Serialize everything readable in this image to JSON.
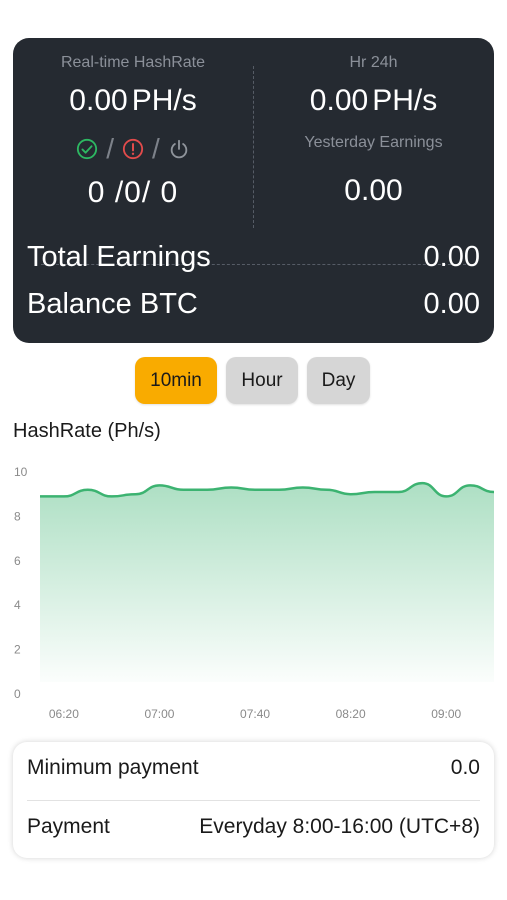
{
  "stats": {
    "realtime_label": "Real-time HashRate",
    "realtime_value": "0.00",
    "realtime_unit": "PH/s",
    "hr24_label": "Hr 24h",
    "hr24_value": "0.00",
    "hr24_unit": "PH/s",
    "status_separator": "/",
    "workers_active": "0",
    "workers_inactive": "0",
    "workers_offline": "0",
    "yesterday_label": "Yesterday Earnings",
    "yesterday_value": "0.00",
    "total_label": "Total Earnings",
    "total_value": "0.00",
    "balance_label": "Balance BTC",
    "balance_value": "0.00"
  },
  "icons": {
    "active": "check-circle-icon",
    "inactive": "exclamation-circle-icon",
    "offline": "power-icon"
  },
  "colors": {
    "card_bg": "#252a31",
    "accent": "#f9ab00",
    "active": "#2db862",
    "inactive": "#e24b4b",
    "offline": "#8f949b",
    "line": "#3cb371"
  },
  "period_tabs": [
    {
      "label": "10min",
      "selected": true
    },
    {
      "label": "Hour",
      "selected": false
    },
    {
      "label": "Day",
      "selected": false
    }
  ],
  "chart_title": "HashRate (Ph/s)",
  "chart_data": {
    "type": "area",
    "title": "HashRate (Ph/s)",
    "xlabel": "",
    "ylabel": "",
    "ylim": [
      0,
      10
    ],
    "yticks": [
      0,
      2,
      4,
      6,
      8,
      10
    ],
    "xticks": [
      "06:20",
      "07:00",
      "07:40",
      "08:20",
      "09:00"
    ],
    "x": [
      "06:10",
      "06:20",
      "06:30",
      "06:40",
      "06:50",
      "07:00",
      "07:10",
      "07:20",
      "07:30",
      "07:40",
      "07:50",
      "08:00",
      "08:10",
      "08:20",
      "08:30",
      "08:40",
      "08:50",
      "09:00",
      "09:10",
      "09:20"
    ],
    "series": [
      {
        "values": [
          8.9,
          8.9,
          9.2,
          8.9,
          9.0,
          9.4,
          9.2,
          9.2,
          9.3,
          9.2,
          9.2,
          9.3,
          9.2,
          9.0,
          9.1,
          9.1,
          9.5,
          8.9,
          9.4,
          9.1
        ]
      }
    ],
    "grid": false,
    "legend": "none"
  },
  "payment": {
    "min_label": "Minimum payment",
    "min_value": "0.0",
    "schedule_label": "Payment",
    "schedule_value": "Everyday 8:00-16:00 (UTC+8)"
  }
}
